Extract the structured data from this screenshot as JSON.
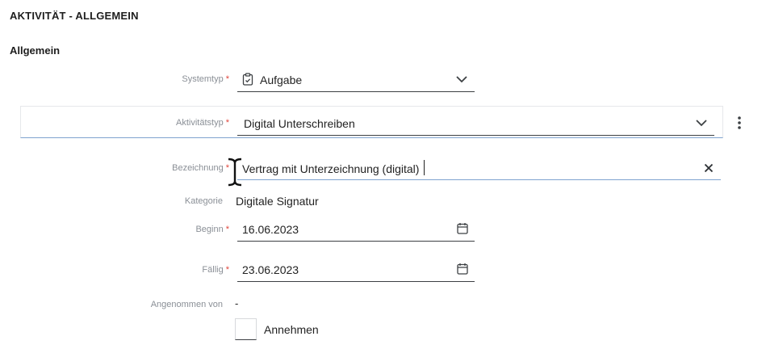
{
  "page": {
    "title": "AKTIVITÄT - ALLGEMEIN",
    "section": "Allgemein"
  },
  "form": {
    "systemtyp": {
      "label": "Systemtyp",
      "required_mark": "*",
      "value": "Aufgabe",
      "icon": "clipboard-check-icon"
    },
    "aktivitaetstyp": {
      "label": "Aktivitätstyp",
      "required_mark": "*",
      "value": "Digital Unterschreiben",
      "menu_icon": "vertical-dots-icon"
    },
    "bezeichnung": {
      "label": "Bezeichnung",
      "required_mark": "*",
      "value": "Vertrag mit Unterzeichnung (digital)",
      "clear_icon": "close-icon"
    },
    "kategorie": {
      "label": "Kategorie",
      "value": "Digitale Signatur"
    },
    "beginn": {
      "label": "Beginn",
      "required_mark": "*",
      "value": "16.06.2023",
      "icon": "calendar-icon"
    },
    "faellig": {
      "label": "Fällig",
      "required_mark": "*",
      "value": "23.06.2023",
      "icon": "calendar-icon"
    },
    "angenommen_von": {
      "label": "Angenommen von",
      "value": "-"
    },
    "annehmen": {
      "label": "Annehmen"
    }
  },
  "colors": {
    "required": "#e0463c",
    "accent_underline": "#7fa3cf",
    "label_gray": "#8a8f96"
  }
}
